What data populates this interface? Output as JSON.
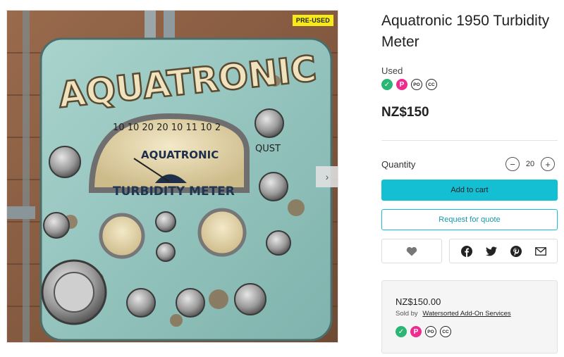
{
  "product": {
    "title": "Aquatronic 1950 Turbidity Meter",
    "condition": "Used",
    "price": "NZ$150",
    "badge": "PRE-USED"
  },
  "image": {
    "brand_text": "AQUATRONIC",
    "dial_brand": "AQUATRONIC",
    "panel_label": "TURBIDITY METER",
    "side_label": "QUST",
    "dial_numbers": [
      "10",
      "10",
      "20",
      "20",
      "10",
      "11",
      "10",
      "2"
    ]
  },
  "payment_icons": [
    {
      "name": "check-pay-icon",
      "glyph": "✓",
      "kind": "check"
    },
    {
      "name": "p-pay-icon",
      "glyph": "P",
      "kind": "p"
    },
    {
      "name": "po-pay-icon",
      "glyph": "PO",
      "kind": "po"
    },
    {
      "name": "cc-pay-icon",
      "glyph": "CC",
      "kind": "cc"
    }
  ],
  "quantity": {
    "label": "Quantity",
    "value": "20",
    "decrement": "−",
    "increment": "+"
  },
  "actions": {
    "add_to_cart": "Add to cart",
    "request_quote": "Request for quote"
  },
  "share": [
    "facebook-icon",
    "twitter-icon",
    "pinterest-icon",
    "email-icon"
  ],
  "seller": {
    "price": "NZ$150.00",
    "sold_by_label": "Sold by",
    "name": "Watersorted Add-On Services"
  },
  "colors": {
    "accent": "#14bfd4",
    "badge": "#f7ea1b",
    "check": "#2bb673",
    "pink": "#ee2b8f"
  }
}
